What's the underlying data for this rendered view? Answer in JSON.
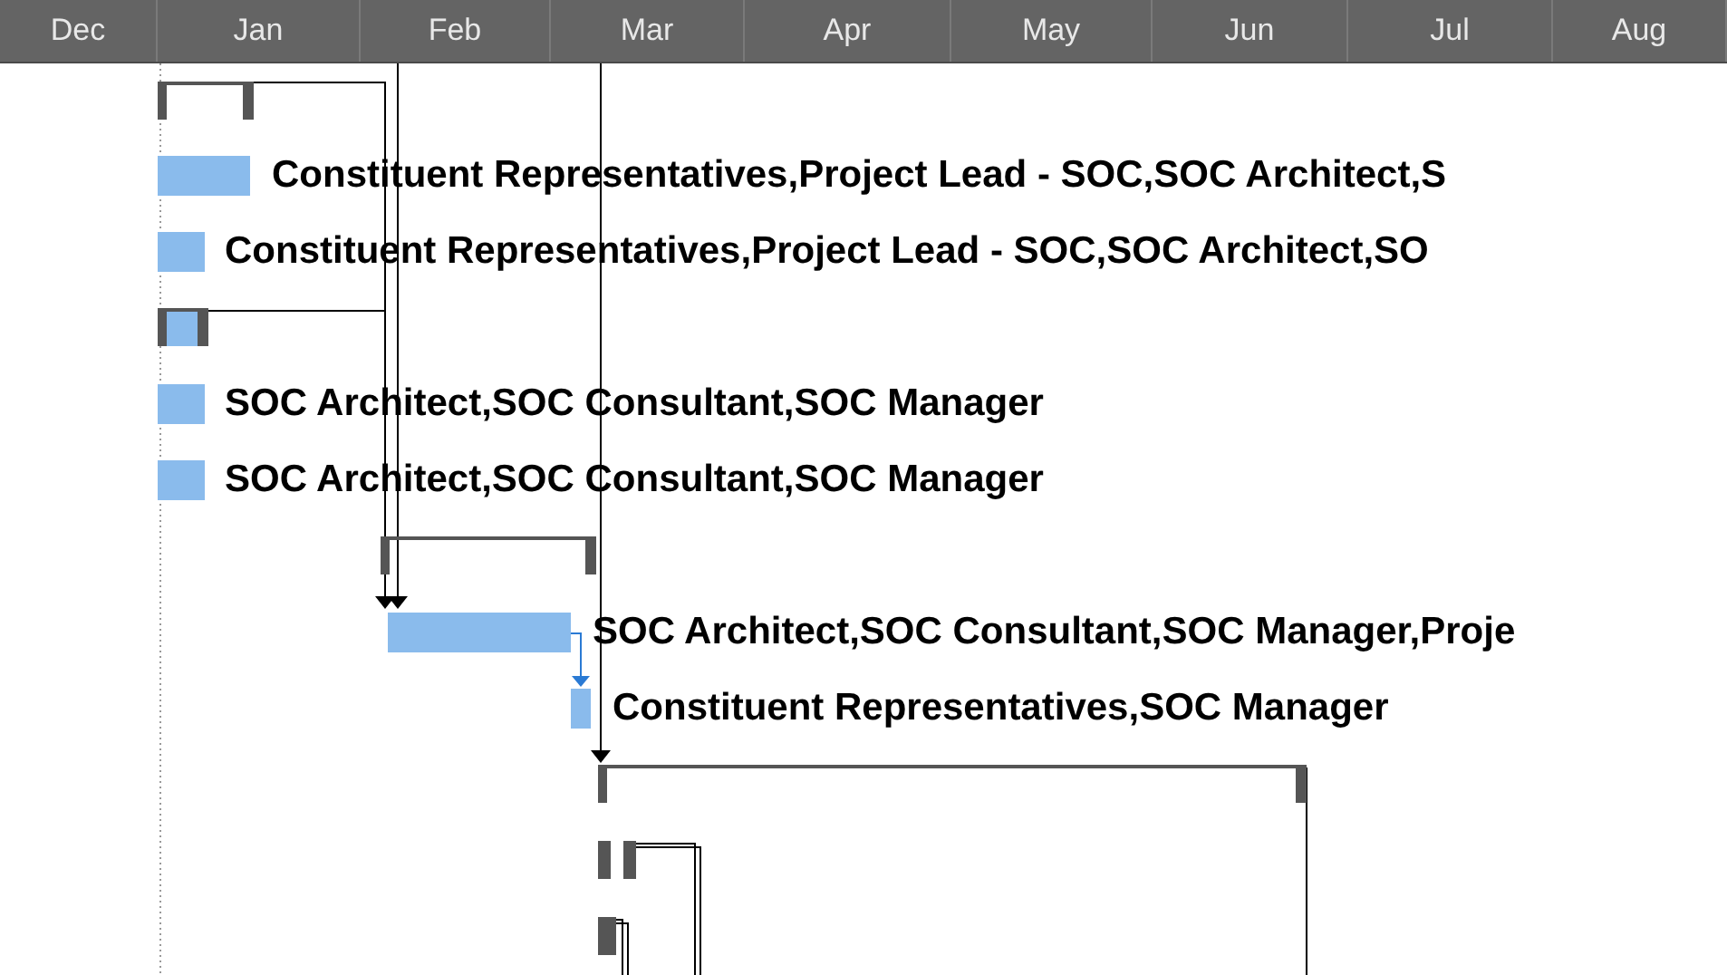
{
  "timeline": {
    "months": [
      "Dec",
      "Jan",
      "Feb",
      "Mar",
      "Apr",
      "May",
      "Jun",
      "Jul",
      "Aug"
    ]
  },
  "tasks": [
    {
      "kind": "summary"
    },
    {
      "kind": "task",
      "label": "Constituent Representatives,Project Lead - SOC,SOC Architect,S"
    },
    {
      "kind": "task",
      "label": "Constituent Representatives,Project Lead - SOC,SOC Architect,SO"
    },
    {
      "kind": "summary"
    },
    {
      "kind": "task",
      "label": "SOC Architect,SOC Consultant,SOC Manager"
    },
    {
      "kind": "task",
      "label": "SOC Architect,SOC Consultant,SOC Manager"
    },
    {
      "kind": "summary"
    },
    {
      "kind": "task",
      "label": "SOC Architect,SOC Consultant,SOC Manager,Proje"
    },
    {
      "kind": "task",
      "label": "Constituent Representatives,SOC Manager"
    },
    {
      "kind": "summary"
    },
    {
      "kind": "marker"
    },
    {
      "kind": "marker"
    }
  ]
}
